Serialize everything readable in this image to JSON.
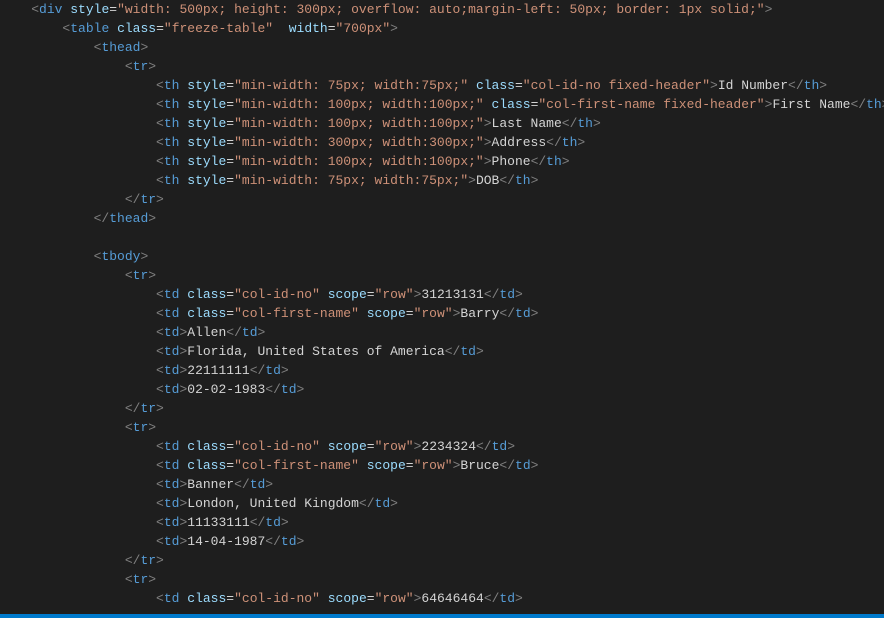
{
  "indent": {
    "u1": "    ",
    "u2": "        ",
    "u3": "            ",
    "u4": "                ",
    "u5": "                    "
  },
  "code": {
    "l1": {
      "tag": "div",
      "attrs": [
        [
          "style",
          "width: 500px; height: 300px; overflow: auto;margin-left: 50px; border: 1px solid;"
        ]
      ],
      "open": true
    },
    "l2": {
      "tag": "table",
      "attrs": [
        [
          "class",
          "freeze-table"
        ],
        [
          "width",
          "700px"
        ]
      ],
      "open": true,
      "dblGap": true
    },
    "l3": {
      "tag": "thead",
      "open": true
    },
    "l4": {
      "tag": "tr",
      "open": true
    },
    "l5": {
      "tag": "th",
      "attrs": [
        [
          "style",
          "min-width: 75px; width:75px;"
        ],
        [
          "class",
          "col-id-no fixed-header"
        ]
      ],
      "text": "Id Number"
    },
    "l6": {
      "tag": "th",
      "attrs": [
        [
          "style",
          "min-width: 100px; width:100px;"
        ],
        [
          "class",
          "col-first-name fixed-header"
        ]
      ],
      "text": "First Name"
    },
    "l7": {
      "tag": "th",
      "attrs": [
        [
          "style",
          "min-width: 100px; width:100px;"
        ]
      ],
      "text": "Last Name"
    },
    "l8": {
      "tag": "th",
      "attrs": [
        [
          "style",
          "min-width: 300px; width:300px;"
        ]
      ],
      "text": "Address"
    },
    "l9": {
      "tag": "th",
      "attrs": [
        [
          "style",
          "min-width: 100px; width:100px;"
        ]
      ],
      "text": "Phone"
    },
    "l10": {
      "tag": "th",
      "attrs": [
        [
          "style",
          "min-width: 75px; width:75px;"
        ]
      ],
      "text": "DOB"
    },
    "l11": {
      "closeTag": "tr"
    },
    "l12": {
      "closeTag": "thead"
    },
    "l14": {
      "tag": "tbody",
      "open": true
    },
    "l15": {
      "tag": "tr",
      "open": true
    },
    "l16": {
      "tag": "td",
      "attrs": [
        [
          "class",
          "col-id-no"
        ],
        [
          "scope",
          "row"
        ]
      ],
      "text": "31213131"
    },
    "l17": {
      "tag": "td",
      "attrs": [
        [
          "class",
          "col-first-name"
        ],
        [
          "scope",
          "row"
        ]
      ],
      "text": "Barry"
    },
    "l18": {
      "tag": "td",
      "text": "Allen"
    },
    "l19": {
      "tag": "td",
      "text": "Florida, United States of America"
    },
    "l20": {
      "tag": "td",
      "text": "22111111"
    },
    "l21": {
      "tag": "td",
      "text": "02-02-1983"
    },
    "l22": {
      "closeTag": "tr"
    },
    "l23": {
      "tag": "tr",
      "open": true
    },
    "l24": {
      "tag": "td",
      "attrs": [
        [
          "class",
          "col-id-no"
        ],
        [
          "scope",
          "row"
        ]
      ],
      "text": "2234324"
    },
    "l25": {
      "tag": "td",
      "attrs": [
        [
          "class",
          "col-first-name"
        ],
        [
          "scope",
          "row"
        ]
      ],
      "text": "Bruce"
    },
    "l26": {
      "tag": "td",
      "text": "Banner"
    },
    "l27": {
      "tag": "td",
      "text": "London, United Kingdom"
    },
    "l28": {
      "tag": "td",
      "text": "11133111"
    },
    "l29": {
      "tag": "td",
      "text": "14-04-1987"
    },
    "l30": {
      "closeTag": "tr"
    },
    "l31": {
      "tag": "tr",
      "open": true
    },
    "l32": {
      "tag": "td",
      "attrs": [
        [
          "class",
          "col-id-no"
        ],
        [
          "scope",
          "row"
        ]
      ],
      "text": "64646464"
    }
  },
  "layout": [
    [
      "u1",
      "l1"
    ],
    [
      "u2",
      "l2"
    ],
    [
      "u3",
      "l3"
    ],
    [
      "u4",
      "l4"
    ],
    [
      "u5",
      "l5"
    ],
    [
      "u5",
      "l6"
    ],
    [
      "u5",
      "l7"
    ],
    [
      "u5",
      "l8"
    ],
    [
      "u5",
      "l9"
    ],
    [
      "u5",
      "l10"
    ],
    [
      "u4",
      "l11"
    ],
    [
      "u3",
      "l12"
    ],
    [
      "",
      "blank"
    ],
    [
      "u3",
      "l14"
    ],
    [
      "u4",
      "l15"
    ],
    [
      "u5",
      "l16"
    ],
    [
      "u5",
      "l17"
    ],
    [
      "u5",
      "l18"
    ],
    [
      "u5",
      "l19"
    ],
    [
      "u5",
      "l20"
    ],
    [
      "u5",
      "l21"
    ],
    [
      "u4",
      "l22"
    ],
    [
      "u4",
      "l23"
    ],
    [
      "u5",
      "l24"
    ],
    [
      "u5",
      "l25"
    ],
    [
      "u5",
      "l26"
    ],
    [
      "u5",
      "l27"
    ],
    [
      "u5",
      "l28"
    ],
    [
      "u5",
      "l29"
    ],
    [
      "u4",
      "l30"
    ],
    [
      "u4",
      "l31"
    ],
    [
      "u5",
      "l32"
    ]
  ]
}
